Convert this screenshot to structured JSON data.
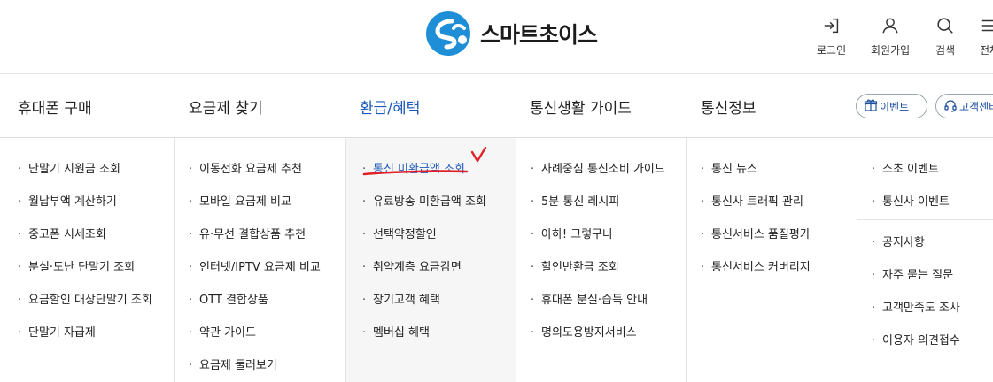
{
  "brand": {
    "name": "스마트초이스"
  },
  "header": {
    "utils": [
      {
        "label": "로그인",
        "icon": "login-icon"
      },
      {
        "label": "회원가입",
        "icon": "user-icon"
      },
      {
        "label": "검색",
        "icon": "search-icon"
      },
      {
        "label": "전체",
        "icon": "menu-icon"
      }
    ]
  },
  "nav": {
    "items": [
      {
        "label": "휴대폰 구매"
      },
      {
        "label": "요금제 찾기"
      },
      {
        "label": "환급/혜택",
        "active": true
      },
      {
        "label": "통신생활 가이드"
      },
      {
        "label": "통신정보"
      }
    ],
    "pills": [
      {
        "label": "이벤트",
        "icon": "gift-icon"
      },
      {
        "label": "고객센터",
        "icon": "headset-icon"
      }
    ]
  },
  "menu": {
    "columns": [
      {
        "items": [
          "단말기 지원금 조회",
          "월납부액 계산하기",
          "중고폰 시세조회",
          "분실·도난 단말기 조회",
          "요금할인 대상단말기 조회",
          "단말기 자급제"
        ]
      },
      {
        "items": [
          "이동전화 요금제 추천",
          "모바일 요금제 비교",
          "유·무선 결합상품 추천",
          "인터넷/IPTV 요금제 비교",
          "OTT 결합상품",
          "약관 가이드",
          "요금제 둘러보기"
        ]
      },
      {
        "items": [
          "통신 미환급액 조회",
          "유료방송 미환급액 조회",
          "선택약정할인",
          "취약계층 요금감면",
          "장기고객 혜택",
          "멤버십 혜택"
        ],
        "active_index": 0
      },
      {
        "items": [
          "사례중심 통신소비 가이드",
          "5분 통신 레시피",
          "아하! 그렇구나",
          "할인반환금 조회",
          "휴대폰 분실·습득 안내",
          "명의도용방지서비스"
        ]
      },
      {
        "items": [
          "통신 뉴스",
          "통신사 트래픽 관리",
          "통신서비스 품질평가",
          "통신서비스 커버리지"
        ]
      },
      {
        "group1": [
          "스초 이벤트",
          "통신사 이벤트"
        ],
        "group2": [
          "공지사항",
          "자주 묻는 질문",
          "고객만족도 조사",
          "이용자 의견접수"
        ]
      }
    ]
  },
  "colors": {
    "accent": "#1f5bb8",
    "annotation": "#e0212b",
    "logo_blue": "#1e8fd6"
  }
}
